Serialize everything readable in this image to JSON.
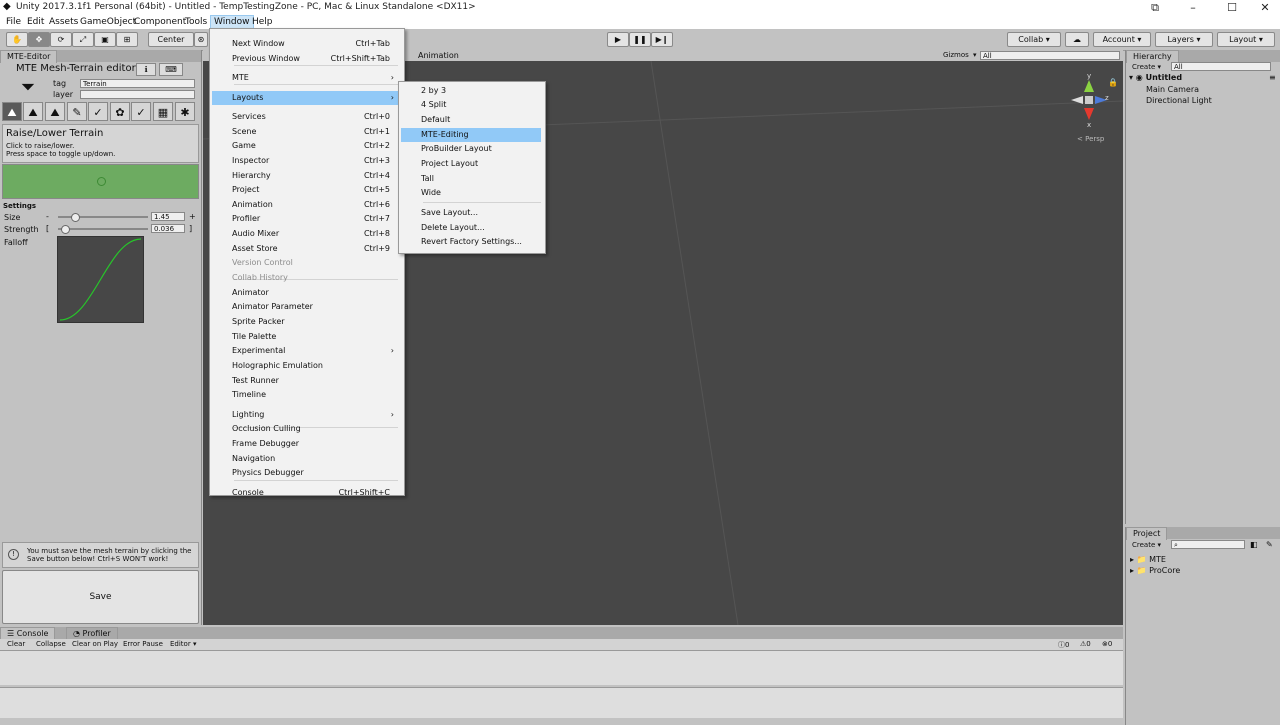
{
  "window": {
    "title": "Unity 2017.3.1f1 Personal (64bit) - Untitled - TempTestingZone - PC, Mac & Linux Standalone <DX11>"
  },
  "menubar": [
    "File",
    "Edit",
    "Assets",
    "GameObject",
    "Component",
    "Tools",
    "Window",
    "Help"
  ],
  "toolbar": {
    "center_label": "Center",
    "collab_label": "Collab",
    "account_label": "Account",
    "layers_label": "Layers",
    "layout_label": "Layout"
  },
  "left_panel": {
    "tab": "MTE-Editor",
    "title": "MTE Mesh-Terrain editor",
    "tag_label": "tag",
    "tag_value": "Terrain",
    "layer_label": "layer",
    "tool_title": "Raise/Lower Terrain",
    "tool_desc1": "Click to raise/lower.",
    "tool_desc2": "Press space to toggle up/down.",
    "settings_label": "Settings",
    "size_label": "Size",
    "size_minus": "-",
    "size_value": "1.45",
    "size_plus": "+",
    "strength_label": "Strength",
    "strength_open": "[",
    "strength_value": "0.036",
    "strength_close": "]",
    "falloff_label": "Falloff",
    "size_fraction": 0.15,
    "strength_fraction": 0.04,
    "warning": "You must save the mesh terrain by clicking the Save button below! Ctrl+S WON'T work!",
    "save_label": "Save"
  },
  "scene": {
    "tab": "Animation",
    "gizmos_label": "Gizmos",
    "search_placeholder": "All",
    "persp_label": "Persp",
    "axis_y": "y",
    "axis_z": "z",
    "axis_x": "x"
  },
  "hierarchy": {
    "tab": "Hierarchy",
    "create_label": "Create",
    "search_placeholder": "All",
    "scene_name": "Untitled",
    "items": [
      "Main Camera",
      "Directional Light"
    ]
  },
  "project": {
    "tab": "Project",
    "create_label": "Create",
    "folders": [
      "MTE",
      "ProCore"
    ]
  },
  "console": {
    "tab_console": "Console",
    "tab_profiler": "Profiler",
    "buttons": [
      "Clear",
      "Collapse",
      "Clear on Play",
      "Error Pause",
      "Editor"
    ],
    "count_info": "0",
    "count_warn": "0",
    "count_error": "0"
  },
  "window_menu": [
    {
      "label": "Next Window",
      "shortcut": "Ctrl+Tab"
    },
    {
      "label": "Previous Window",
      "shortcut": "Ctrl+Shift+Tab"
    },
    {
      "label": "MTE",
      "shortcut": "",
      "submenu": true
    },
    {
      "label": "Layouts",
      "shortcut": "",
      "submenu": true,
      "highlight": true
    },
    {
      "label": "Services",
      "shortcut": "Ctrl+0"
    },
    {
      "label": "Scene",
      "shortcut": "Ctrl+1"
    },
    {
      "label": "Game",
      "shortcut": "Ctrl+2"
    },
    {
      "label": "Inspector",
      "shortcut": "Ctrl+3"
    },
    {
      "label": "Hierarchy",
      "shortcut": "Ctrl+4"
    },
    {
      "label": "Project",
      "shortcut": "Ctrl+5"
    },
    {
      "label": "Animation",
      "shortcut": "Ctrl+6"
    },
    {
      "label": "Profiler",
      "shortcut": "Ctrl+7"
    },
    {
      "label": "Audio Mixer",
      "shortcut": "Ctrl+8"
    },
    {
      "label": "Asset Store",
      "shortcut": "Ctrl+9"
    },
    {
      "label": "Version Control",
      "shortcut": "",
      "disabled": true
    },
    {
      "label": "Collab History",
      "shortcut": "",
      "disabled": true
    },
    {
      "label": "Animator",
      "shortcut": ""
    },
    {
      "label": "Animator Parameter",
      "shortcut": ""
    },
    {
      "label": "Sprite Packer",
      "shortcut": ""
    },
    {
      "label": "Tile Palette",
      "shortcut": ""
    },
    {
      "label": "Experimental",
      "shortcut": "",
      "submenu": true
    },
    {
      "label": "Holographic Emulation",
      "shortcut": ""
    },
    {
      "label": "Test Runner",
      "shortcut": ""
    },
    {
      "label": "Timeline",
      "shortcut": ""
    },
    {
      "label": "Lighting",
      "shortcut": "",
      "submenu": true
    },
    {
      "label": "Occlusion Culling",
      "shortcut": ""
    },
    {
      "label": "Frame Debugger",
      "shortcut": ""
    },
    {
      "label": "Navigation",
      "shortcut": ""
    },
    {
      "label": "Physics Debugger",
      "shortcut": ""
    },
    {
      "label": "Console",
      "shortcut": "Ctrl+Shift+C"
    }
  ],
  "layouts_menu": [
    {
      "label": "2 by 3"
    },
    {
      "label": "4 Split"
    },
    {
      "label": "Default"
    },
    {
      "label": "MTE-Editing",
      "highlight": true
    },
    {
      "label": "ProBuilder Layout"
    },
    {
      "label": "Project Layout"
    },
    {
      "label": "Tall"
    },
    {
      "label": "Wide"
    },
    {
      "label": "Save Layout..."
    },
    {
      "label": "Delete Layout..."
    },
    {
      "label": "Revert Factory Settings..."
    }
  ]
}
